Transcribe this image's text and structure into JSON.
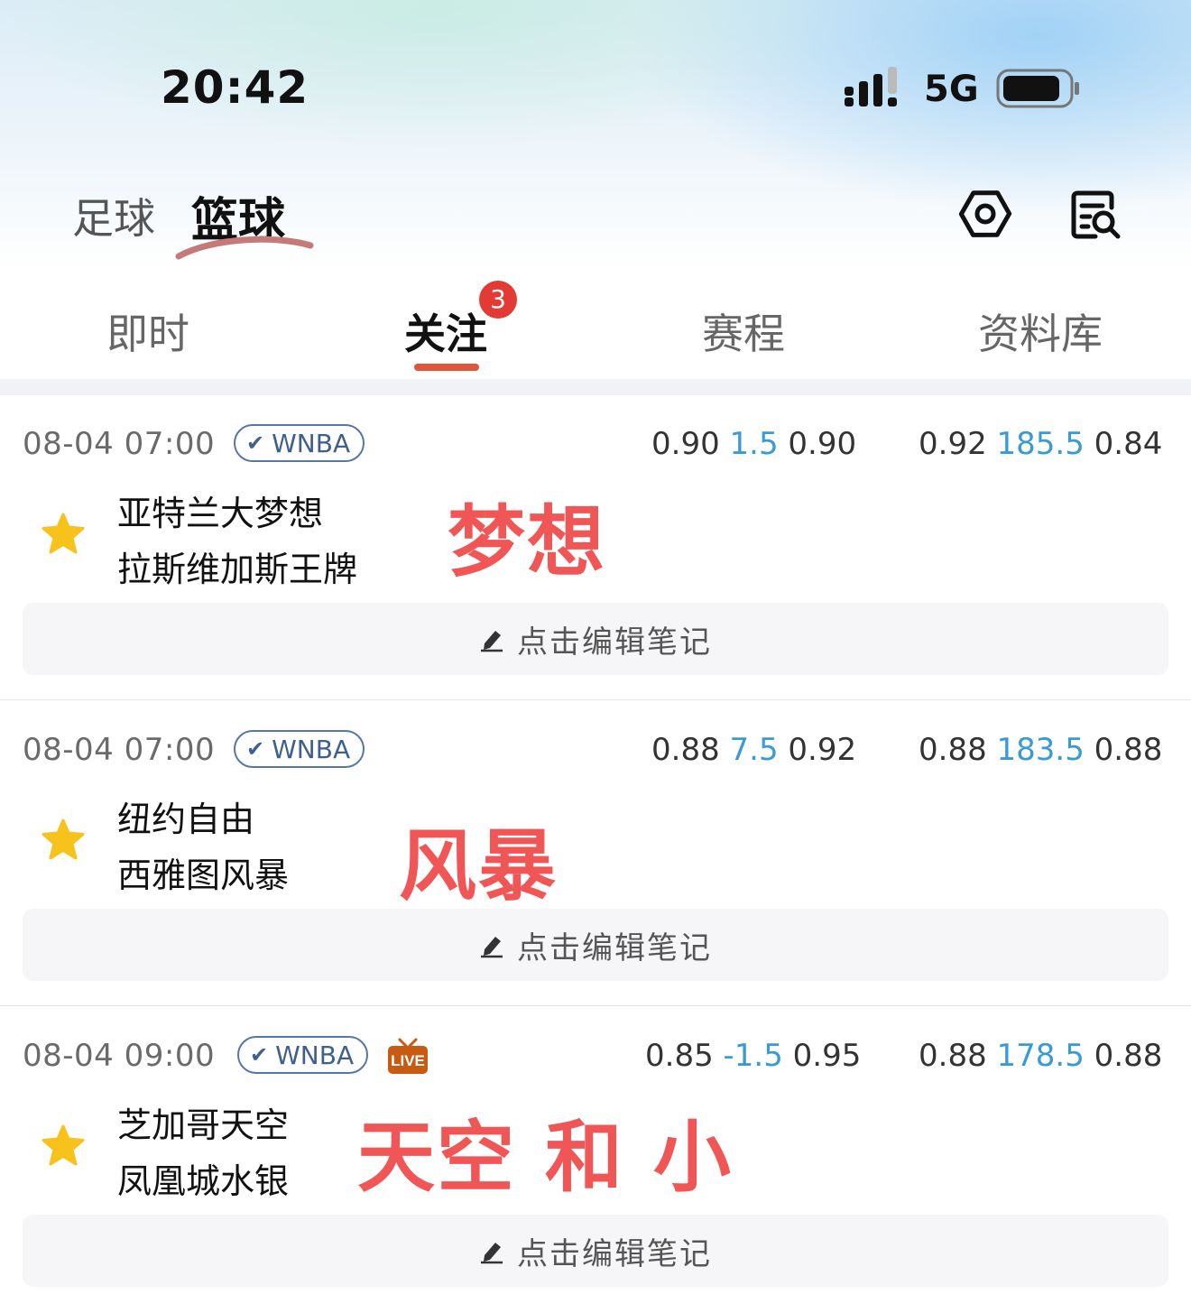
{
  "status_bar": {
    "time": "20:42",
    "network": "5G"
  },
  "sport_tabs": [
    {
      "label": "足球",
      "active": false
    },
    {
      "label": "篮球",
      "active": true
    }
  ],
  "sub_tabs": [
    {
      "label": "即时",
      "active": false
    },
    {
      "label": "关注",
      "active": true,
      "badge": "3"
    },
    {
      "label": "赛程",
      "active": false
    },
    {
      "label": "资料库",
      "active": false
    }
  ],
  "matches": [
    {
      "time": "08-04 07:00",
      "league": "WNBA",
      "live": false,
      "handicap": {
        "home_odds": "0.90",
        "line": "1.5",
        "away_odds": "0.90"
      },
      "total": {
        "over_odds": "0.92",
        "line": "185.5",
        "under_odds": "0.84"
      },
      "home_team": "亚特兰大梦想",
      "away_team": "拉斯维加斯王牌",
      "overlay": "梦想",
      "note_label": "点击编辑笔记",
      "followed": true
    },
    {
      "time": "08-04 07:00",
      "league": "WNBA",
      "live": false,
      "handicap": {
        "home_odds": "0.88",
        "line": "7.5",
        "away_odds": "0.92"
      },
      "total": {
        "over_odds": "0.88",
        "line": "183.5",
        "under_odds": "0.88"
      },
      "home_team": "纽约自由",
      "away_team": "西雅图风暴",
      "overlay": "风暴",
      "note_label": "点击编辑笔记",
      "followed": true
    },
    {
      "time": "08-04 09:00",
      "league": "WNBA",
      "live": true,
      "live_label": "LIVE",
      "handicap": {
        "home_odds": "0.85",
        "line": "-1.5",
        "away_odds": "0.95"
      },
      "total": {
        "over_odds": "0.88",
        "line": "178.5",
        "under_odds": "0.88"
      },
      "home_team": "芝加哥天空",
      "away_team": "凤凰城水银",
      "overlay": "天空 和 小",
      "note_label": "点击编辑笔记",
      "followed": true
    }
  ],
  "colors": {
    "accent": "#e0563a",
    "badge": "#e23b35",
    "odds_line": "#3a9ad6",
    "overlay_text": "#f05656",
    "star": "#f7c21c",
    "league_tag": "#3f5f8e"
  }
}
